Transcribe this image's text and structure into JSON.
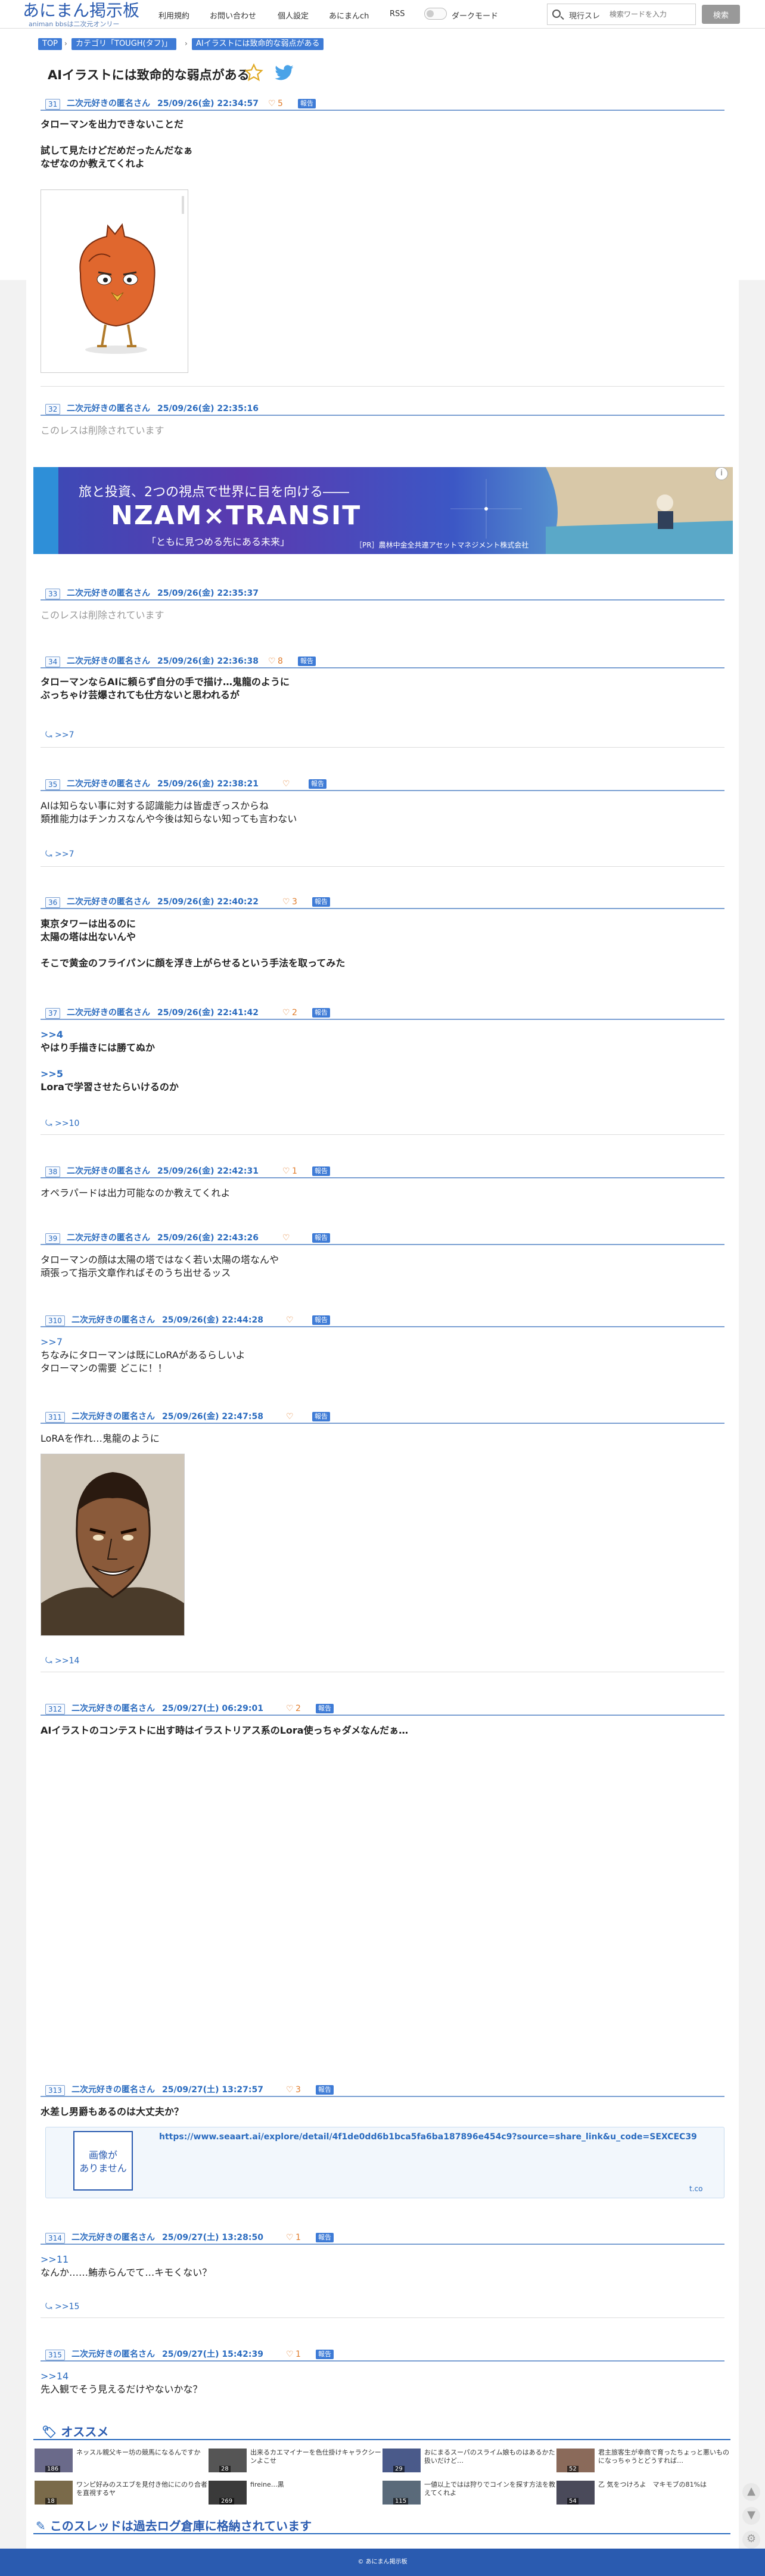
{
  "header": {
    "logo_title": "あにまん掲示板",
    "logo_sub": "animan bbsは二次元オンリー",
    "nav": [
      "利用規約",
      "お問い合わせ",
      "個人設定",
      "あにまんch",
      "RSS"
    ],
    "dark_mode_label": "ダークモード",
    "search_type": "現行スレ",
    "search_placeholder": "検索ワードを入力",
    "search_button": "検索"
  },
  "breadcrumb": [
    "TOP",
    "カテゴリ「TOUGH(タフ)」",
    "AIイラストには致命的な弱点がある"
  ],
  "thread_title": "AIイラストには致命的な弱点がある",
  "posts": [
    {
      "no": "31",
      "name": "二次元好きの匿名さん",
      "date": "25/09/26(金) 22:34:57",
      "likes": "5",
      "report": "報告",
      "lines": [
        "タローマンを出力できないことだ",
        "",
        "試して見たけどだめだったんだなぁ",
        "なぜなのか教えてくれよ"
      ]
    },
    {
      "no": "32",
      "name": "二次元好きの匿名さん",
      "date": "25/09/26(金) 22:35:16",
      "deleted": "このレスは削除されています"
    },
    {
      "no": "33",
      "name": "二次元好きの匿名さん",
      "date": "25/09/26(金) 22:35:37",
      "deleted": "このレスは削除されています"
    },
    {
      "no": "34",
      "name": "二次元好きの匿名さん",
      "date": "25/09/26(金) 22:36:38",
      "likes": "8",
      "report": "報告",
      "lines": [
        "タローマンならAIに頼らず自分の手で描け…鬼龍のように",
        "ぶっちゃけ芸爆されても仕方ないと思われるが"
      ],
      "replies": ">>7"
    },
    {
      "no": "35",
      "name": "二次元好きの匿名さん",
      "date": "25/09/26(金) 22:38:21",
      "likes": "",
      "report": "報告",
      "lines": [
        "AIは知らない事に対する認識能力は皆虚ぎっスからね",
        "類推能力はチンカスなんや今後は知らない知っても言わない"
      ],
      "replies": ">>7"
    },
    {
      "no": "36",
      "name": "二次元好きの匿名さん",
      "date": "25/09/26(金) 22:40:22",
      "likes": "3",
      "report": "報告",
      "lines": [
        "東京タワーは出るのに",
        "太陽の塔は出ないんや",
        "",
        "そこで黄金のフライパンに顔を浮き上がらせるという手法を取ってみた"
      ]
    },
    {
      "no": "37",
      "name": "二次元好きの匿名さん",
      "date": "25/09/26(金) 22:41:42",
      "likes": "2",
      "report": "報告",
      "lines": [
        ">>4",
        "やはり手描きには勝てぬか",
        "",
        ">>5",
        "Loraで学習させたらいけるのか"
      ],
      "replies": ">>10"
    },
    {
      "no": "38",
      "name": "二次元好きの匿名さん",
      "date": "25/09/26(金) 22:42:31",
      "likes": "1",
      "report": "報告",
      "lines": [
        "オペラパードは出力可能なのか教えてくれよ"
      ]
    },
    {
      "no": "39",
      "name": "二次元好きの匿名さん",
      "date": "25/09/26(金) 22:43:26",
      "likes": "",
      "report": "報告",
      "lines": [
        "タローマンの顔は太陽の塔ではなく若い太陽の塔なんや",
        "頑張って指示文章作ればそのうち出せるッス"
      ]
    },
    {
      "no": "310",
      "name": "二次元好きの匿名さん",
      "date": "25/09/26(金) 22:44:28",
      "likes": "",
      "report": "報告",
      "lines": [
        ">>7",
        "ちなみにタローマンは既にLoRAがあるらしいよ",
        "タローマンの需要 どこに！！"
      ]
    },
    {
      "no": "311",
      "name": "二次元好きの匿名さん",
      "date": "25/09/26(金) 22:47:58",
      "likes": "",
      "report": "報告",
      "lines": [
        "LoRAを作れ…鬼龍のように"
      ],
      "replies": ">>14"
    },
    {
      "no": "312",
      "name": "二次元好きの匿名さん",
      "date": "25/09/27(土) 06:29:01",
      "likes": "2",
      "report": "報告",
      "lines": [
        "AIイラストのコンテストに出す時はイラストリアス系のLora使っちゃダメなんだぁ…"
      ]
    },
    {
      "no": "313",
      "name": "二次元好きの匿名さん",
      "date": "25/09/27(土) 13:27:57",
      "likes": "3",
      "report": "報告",
      "lines": [
        "水差し男爵もあるのは大丈夫か？"
      ]
    },
    {
      "no": "314",
      "name": "二次元好きの匿名さん",
      "date": "25/09/27(土) 13:28:50",
      "likes": "1",
      "report": "報告",
      "lines": [
        ">>11",
        "なんか……鮪赤らんでて…キモくない？"
      ],
      "replies": ">>15"
    },
    {
      "no": "315",
      "name": "二次元好きの匿名さん",
      "date": "25/09/27(土) 15:42:39",
      "likes": "1",
      "report": "報告",
      "lines": [
        ">>14",
        "先入観でそう見えるだけやないかな？"
      ]
    }
  ],
  "ad": {
    "line1": "旅と投資、2つの視点で世界に目を向ける――",
    "line2": "NZAM×TRANSIT",
    "line3": "「ともに見つめる先にある未来」",
    "line4": "［PR］農林中金全共連アセットマネジメント株式会社",
    "info": "i"
  },
  "link_card": {
    "no_image": "画像が\nありません",
    "url": "https://www.seaart.ai/explore/detail/4f1de0dd6b1bca5fa6ba187896e454c9?source=share_link&u_code=SEXCEC39",
    "domain": "t.co"
  },
  "recommend": {
    "heading": "オススメ",
    "items": [
      {
        "title": "ネッスル親父キー坊の競馬になるんですか",
        "count": "186"
      },
      {
        "title": "出来るカエマイナーを色仕掛けキャラクシーンよこせ",
        "count": "28"
      },
      {
        "title": "おにまるスーパのスライム娘ものはあるかた扱いだけど…",
        "count": "29"
      },
      {
        "title": "君主旅客生が幸商で育ったちょっと悪いものになっちゃうとどうすれば…",
        "count": "52"
      },
      {
        "title": "ワンピ好みのスエブを見付き他ににのり合者を直視するヤ",
        "count": "18"
      },
      {
        "title": "fireine…黒",
        "count": "269"
      },
      {
        "title": "一値以上ではは狩りでコインを探す方法を教えてくれよ",
        "count": "115"
      },
      {
        "title": "乙 気をつけろよ　マキモブの81%は",
        "count": "54"
      }
    ]
  },
  "archive_notice": "このスレッドは過去ログ倉庫に格納されています",
  "footer": "© あにまん掲示板",
  "colors": {
    "accent": "#2a6bbf",
    "brand": "#2a5bb0",
    "like": "#e07b2a"
  }
}
